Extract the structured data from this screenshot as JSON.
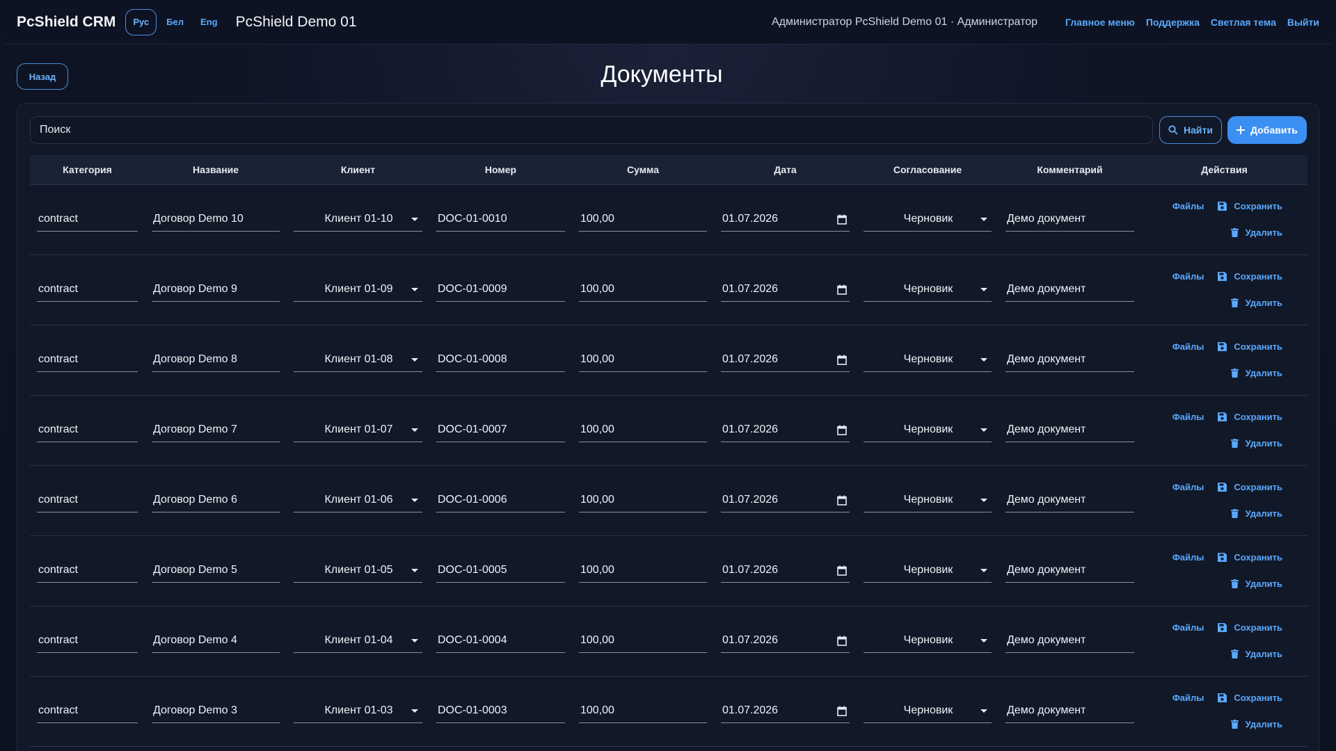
{
  "app": {
    "brand": "PcShield CRM",
    "languages": [
      "Рус",
      "Бел",
      "Eng"
    ],
    "company": "PcShield Demo 01",
    "user": "Администратор PcShield Demo 01 · Администратор",
    "nav": [
      "Главное меню",
      "Поддержка",
      "Светлая тема",
      "Выйти"
    ]
  },
  "page": {
    "back_label": "Назад",
    "title": "Документы"
  },
  "toolbar": {
    "search_value": "Поиск",
    "find_label": "Найти",
    "add_label": "Добавить"
  },
  "table": {
    "headers": [
      "Категория",
      "Название",
      "Клиент",
      "Номер",
      "Сумма",
      "Дата",
      "Согласование",
      "Комментарий",
      "Действия"
    ],
    "actions": {
      "files": "Файлы",
      "save": "Сохранить",
      "delete": "Удалить"
    },
    "rows": [
      {
        "category": "contract",
        "name": "Договор Demo 10",
        "client": "Клиент 01-10",
        "number": "DOC-01-0010",
        "amount": "100,00",
        "date": "01.07.2026",
        "approval": "Черновик",
        "comment": "Демо документ"
      },
      {
        "category": "contract",
        "name": "Договор Demo 9",
        "client": "Клиент 01-09",
        "number": "DOC-01-0009",
        "amount": "100,00",
        "date": "01.07.2026",
        "approval": "Черновик",
        "comment": "Демо документ"
      },
      {
        "category": "contract",
        "name": "Договор Demo 8",
        "client": "Клиент 01-08",
        "number": "DOC-01-0008",
        "amount": "100,00",
        "date": "01.07.2026",
        "approval": "Черновик",
        "comment": "Демо документ"
      },
      {
        "category": "contract",
        "name": "Договор Demo 7",
        "client": "Клиент 01-07",
        "number": "DOC-01-0007",
        "amount": "100,00",
        "date": "01.07.2026",
        "approval": "Черновик",
        "comment": "Демо документ"
      },
      {
        "category": "contract",
        "name": "Договор Demo 6",
        "client": "Клиент 01-06",
        "number": "DOC-01-0006",
        "amount": "100,00",
        "date": "01.07.2026",
        "approval": "Черновик",
        "comment": "Демо документ"
      },
      {
        "category": "contract",
        "name": "Договор Demo 5",
        "client": "Клиент 01-05",
        "number": "DOC-01-0005",
        "amount": "100,00",
        "date": "01.07.2026",
        "approval": "Черновик",
        "comment": "Демо документ"
      },
      {
        "category": "contract",
        "name": "Договор Demo 4",
        "client": "Клиент 01-04",
        "number": "DOC-01-0004",
        "amount": "100,00",
        "date": "01.07.2026",
        "approval": "Черновик",
        "comment": "Демо документ"
      },
      {
        "category": "contract",
        "name": "Договор Demo 3",
        "client": "Клиент 01-03",
        "number": "DOC-01-0003",
        "amount": "100,00",
        "date": "01.07.2026",
        "approval": "Черновик",
        "comment": "Демо документ"
      }
    ]
  },
  "colors": {
    "accent": "#3b8ff2",
    "link": "#5aa9ff",
    "background": "#0c1220",
    "card": "#111827"
  }
}
